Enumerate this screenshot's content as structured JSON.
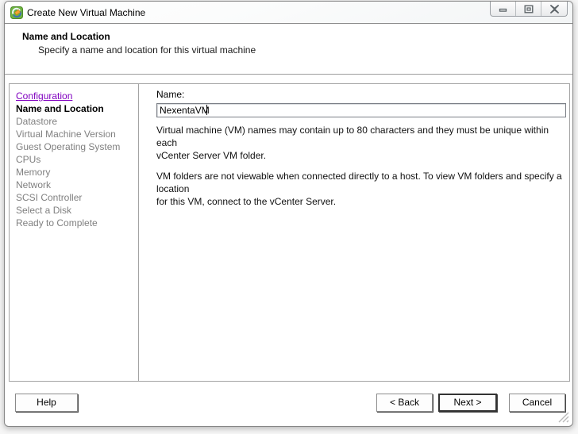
{
  "window": {
    "title": "Create New Virtual Machine",
    "icon": "vsphere-app-icon",
    "controls": [
      "minimize",
      "restore",
      "close"
    ]
  },
  "header": {
    "title": "Name and Location",
    "subtitle": "Specify a name and location for this virtual machine"
  },
  "sidebar": {
    "items": [
      {
        "label": "Configuration",
        "state": "link"
      },
      {
        "label": "Name and Location",
        "state": "current"
      },
      {
        "label": "Datastore",
        "state": "upcoming"
      },
      {
        "label": "Virtual Machine Version",
        "state": "upcoming"
      },
      {
        "label": "Guest Operating System",
        "state": "upcoming"
      },
      {
        "label": "CPUs",
        "state": "upcoming"
      },
      {
        "label": "Memory",
        "state": "upcoming"
      },
      {
        "label": "Network",
        "state": "upcoming"
      },
      {
        "label": "SCSI Controller",
        "state": "upcoming"
      },
      {
        "label": "Select a Disk",
        "state": "upcoming"
      },
      {
        "label": "Ready to Complete",
        "state": "upcoming"
      }
    ]
  },
  "form": {
    "name_label": "Name:",
    "name_value": "NexentaVM",
    "help_text_1": "Virtual machine (VM) names may contain up to 80 characters and they must be unique within each\nvCenter Server VM folder.",
    "help_text_2": "VM folders are not viewable when connected directly to a host. To view VM folders and specify a location\nfor this VM, connect to the vCenter Server."
  },
  "buttons": {
    "help": "Help",
    "back": "< Back",
    "next": "Next >",
    "cancel": "Cancel"
  },
  "colors": {
    "link_purple": "#8000C0",
    "inactive_gray": "#808080",
    "panel_border": "#a3a3a3"
  }
}
